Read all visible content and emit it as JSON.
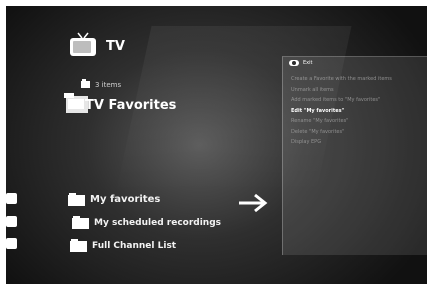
{
  "header": {
    "title": "TV",
    "icon": "tv-icon"
  },
  "folder": {
    "count": "3 items",
    "title": "TV Favorites",
    "icon": "favorites-folder-icon"
  },
  "list": {
    "items": [
      {
        "label": "My favorites",
        "icon": "folder-icon",
        "selected": true
      },
      {
        "label": "My scheduled recordings",
        "icon": "folder-icon",
        "selected": false
      },
      {
        "label": "Full Channel List",
        "icon": "folder-icon",
        "selected": false
      }
    ]
  },
  "context_menu": {
    "exit_label": "Exit",
    "items": [
      "Create a Favorite with the marked items",
      "Unmark all items",
      "Add marked items to \"My favorites\"",
      "Edit \"My favorites\"",
      "Rename \"My favorites\"",
      "Delete \"My favorites\"",
      "Display EPG"
    ],
    "active_index": 3
  },
  "colors": {
    "background": "#111111",
    "text": "#ffffff",
    "inactive_menu_text": "#8f8f8f"
  }
}
